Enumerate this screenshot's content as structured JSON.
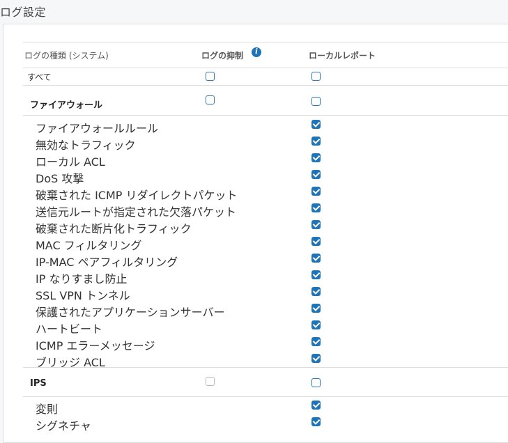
{
  "page": {
    "title": "ログ設定"
  },
  "header": {
    "type_label": "ログの種類 (システム)",
    "suppress_label": "ログの抑制",
    "local_report_label": "ローカルレポート",
    "info_glyph": "i"
  },
  "all_row": {
    "label": "すべて",
    "suppress": false,
    "local": false
  },
  "sections": [
    {
      "label": "ファイアウォール",
      "suppress": false,
      "suppress_disabled": false,
      "local": false,
      "items": [
        {
          "label": "ファイアウォールルール",
          "local": true
        },
        {
          "label": "無効なトラフィック",
          "local": true
        },
        {
          "label": "ローカル ACL",
          "local": true
        },
        {
          "label": "DoS 攻撃",
          "local": true
        },
        {
          "label": "破棄された ICMP リダイレクトパケット",
          "local": true
        },
        {
          "label": "送信元ルートが指定された欠落パケット",
          "local": true
        },
        {
          "label": "破棄された断片化トラフィック",
          "local": true
        },
        {
          "label": "MAC フィルタリング",
          "local": true
        },
        {
          "label": "IP-MAC ペアフィルタリング",
          "local": true
        },
        {
          "label": "IP なりすまし防止",
          "local": true
        },
        {
          "label": "SSL VPN トンネル",
          "local": true
        },
        {
          "label": "保護されたアプリケーションサーバー",
          "local": true
        },
        {
          "label": "ハートビート",
          "local": true
        },
        {
          "label": "ICMP エラーメッセージ",
          "local": true
        },
        {
          "label": "ブリッジ ACL",
          "local": true
        }
      ]
    },
    {
      "label": "IPS",
      "suppress": false,
      "suppress_disabled": true,
      "local": false,
      "items": [
        {
          "label": "変則",
          "local": true
        },
        {
          "label": "シグネチャ",
          "local": true
        }
      ]
    }
  ]
}
